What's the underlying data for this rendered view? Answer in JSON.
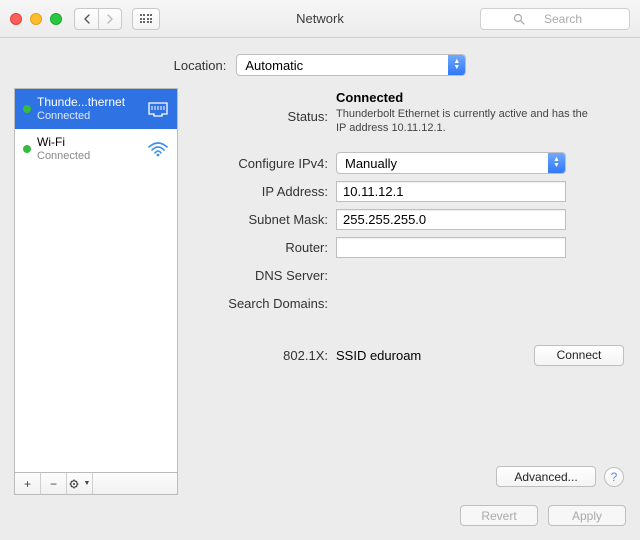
{
  "window": {
    "title": "Network",
    "search_placeholder": "Search"
  },
  "location": {
    "label": "Location:",
    "value": "Automatic"
  },
  "services": [
    {
      "name": "Thunde...thernet",
      "status": "Connected",
      "selected": true,
      "type": "ethernet"
    },
    {
      "name": "Wi-Fi",
      "status": "Connected",
      "selected": false,
      "type": "wifi"
    }
  ],
  "detail": {
    "status_label": "Status:",
    "status_value": "Connected",
    "status_detail": "Thunderbolt Ethernet is currently active and has the IP address 10.11.12.1.",
    "configure_label": "Configure IPv4:",
    "configure_value": "Manually",
    "ip_label": "IP Address:",
    "ip_value": "10.11.12.1",
    "subnet_label": "Subnet Mask:",
    "subnet_value": "255.255.255.0",
    "router_label": "Router:",
    "router_value": "",
    "dns_label": "DNS Server:",
    "search_domains_label": "Search Domains:",
    "x8021_label": "802.1X:",
    "x8021_value": "SSID eduroam",
    "connect_label": "Connect",
    "advanced_label": "Advanced..."
  },
  "buttons": {
    "revert": "Revert",
    "apply": "Apply"
  }
}
